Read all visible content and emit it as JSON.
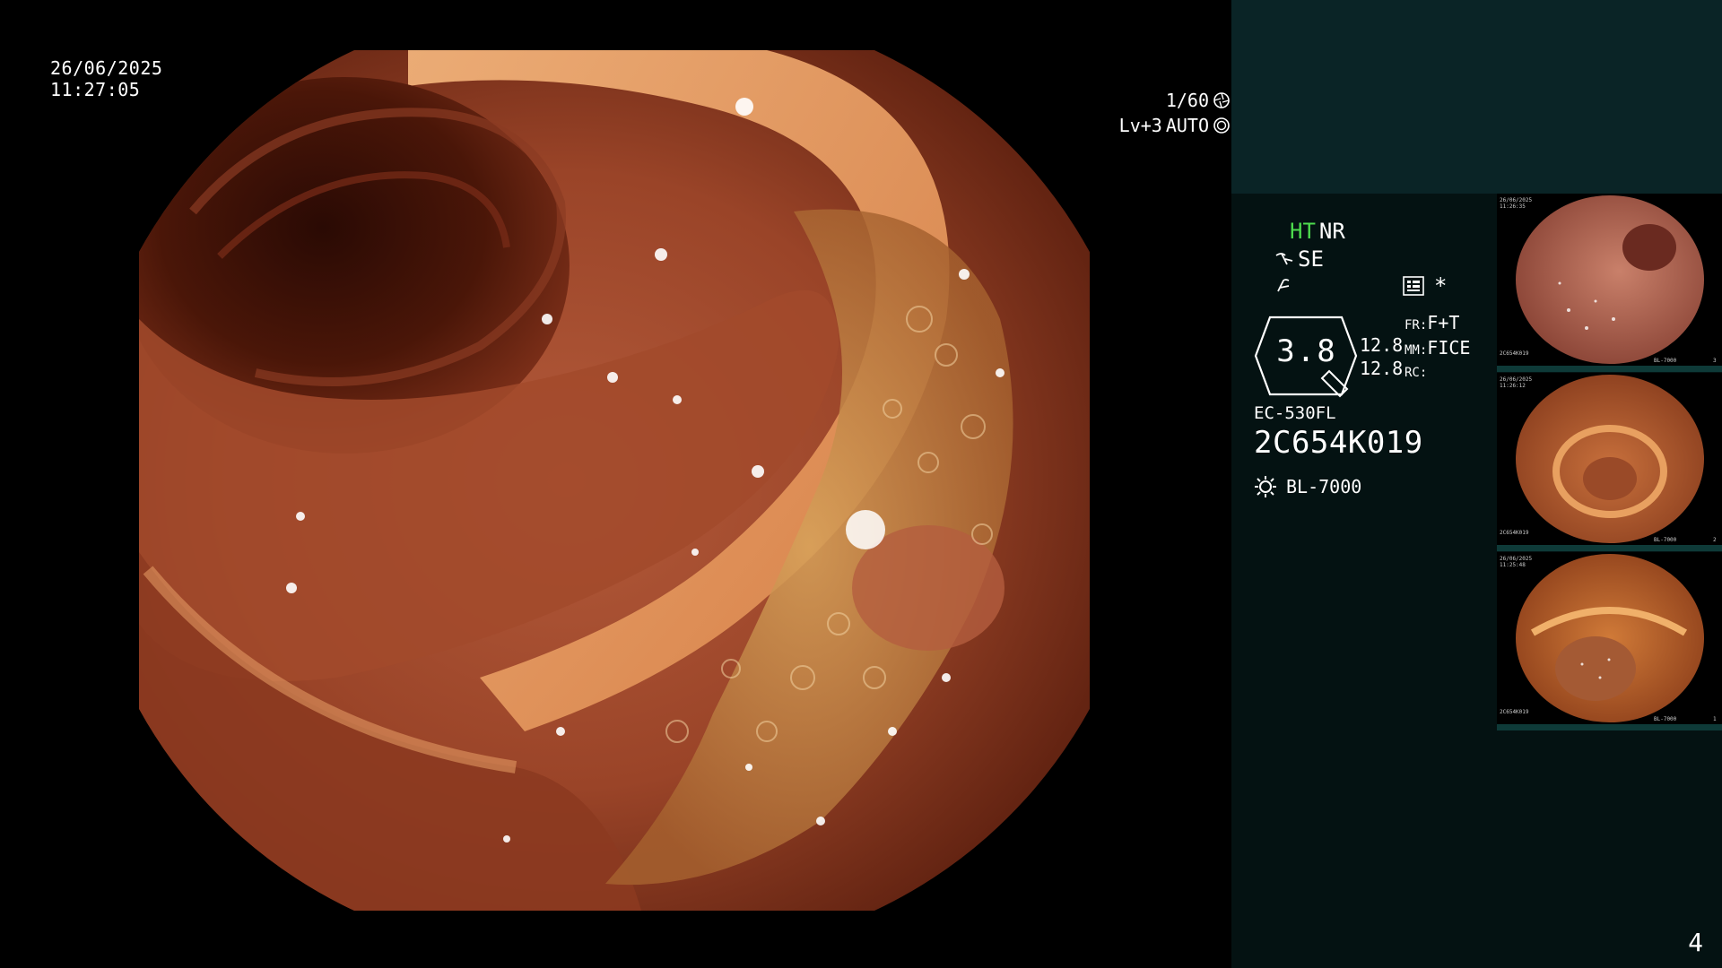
{
  "overlay": {
    "date": "26/06/2025",
    "time": "11:27:05",
    "shutter": "1/60",
    "iris_level": "Lv+3",
    "iris_mode": "AUTO"
  },
  "panel": {
    "mode_ht": "HT",
    "mode_nr": "NR",
    "mode_se": "SE",
    "asterisk": "*",
    "zoom": "3.8",
    "zoom_value_1": "12.8",
    "zoom_value_2": "12.8",
    "fr_label": "FR:",
    "fr_value": "F+T",
    "mm_label": "MM:",
    "mm_value": "FICE",
    "rc_label": "RC:",
    "scope_model": "EC-530FL",
    "scope_serial": "2C654K019",
    "light_source": "BL-7000",
    "page_number": "4"
  },
  "colors": {
    "panel_bg": "#041212",
    "panel_top": "#0a2426",
    "ht_green": "#4ddb4d",
    "thumb_bar": "#0e3a38"
  },
  "icons": [
    "shutter-icon",
    "iris-icon",
    "structure-icon",
    "enhance-icon",
    "menu-icon",
    "zoom-badge-icon",
    "light-source-icon"
  ],
  "thumbnails": [
    {
      "index": "3",
      "date": "26/06/2025",
      "time": "11:26:35",
      "serial": "2C654K019",
      "light": "BL-7000"
    },
    {
      "index": "2",
      "date": "26/06/2025",
      "time": "11:26:12",
      "serial": "2C654K019",
      "light": "BL-7000"
    },
    {
      "index": "1",
      "date": "26/06/2025",
      "time": "11:25:48",
      "serial": "2C654K019",
      "light": "BL-7000"
    }
  ]
}
